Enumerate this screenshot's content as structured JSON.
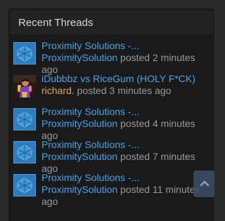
{
  "widget": {
    "title": "Recent Threads"
  },
  "colors": {
    "link": "#4aa3e6",
    "staff_name": "#e7a64a",
    "meta_text": "#9a9a9a"
  },
  "threads": [
    {
      "title": "Proximity Solutions -...",
      "poster": "ProximitySolution",
      "action": "posted",
      "time": "2 minutes ago",
      "avatar": "proximity-logo-icon"
    },
    {
      "title": "iDubbbz vs RiceGum (HOLY F*CK)",
      "poster": "richard.",
      "action": "posted",
      "time": "3 minutes ago",
      "avatar": "user-avatar"
    },
    {
      "title": "Proximity Solutions -...",
      "poster": "ProximitySolution",
      "action": "posted",
      "time": "4 minutes ago",
      "avatar": "proximity-logo-icon"
    },
    {
      "title": "Proximity Solutions -...",
      "poster": "ProximitySolution",
      "action": "posted",
      "time": "7 minutes ago",
      "avatar": "proximity-logo-icon"
    },
    {
      "title": "Proximity Solutions -...",
      "poster": "ProximitySolution",
      "action": "posted",
      "time": "11 minutes ago",
      "avatar": "proximity-logo-icon"
    }
  ],
  "scroll_top": {
    "icon": "chevron-up-icon"
  }
}
